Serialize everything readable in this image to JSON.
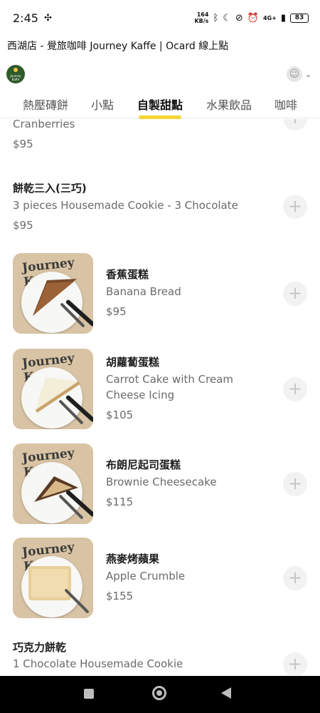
{
  "status": {
    "time": "2:45",
    "net_speed_value": "164",
    "net_speed_unit": "KB/s",
    "network": "4G+",
    "battery": "83"
  },
  "web_title": "西湖店 - 覺旅咖啡 Journey Kaffe | Ocard 線上點",
  "logo_text": "Journey Kaffe",
  "tabs": [
    {
      "label": "熱壓磚餅"
    },
    {
      "label": "小點"
    },
    {
      "label": "自製甜點",
      "active": true
    },
    {
      "label": "水果飲品"
    },
    {
      "label": "咖啡"
    }
  ],
  "items": [
    {
      "name": "",
      "desc": "Cranberries",
      "price": "$95"
    },
    {
      "name": "餅乾三入(三巧)",
      "desc": "3 pieces Housemade Cookie - 3 Chocolate",
      "price": "$95"
    },
    {
      "name": "香蕉蛋糕",
      "desc": "Banana Bread",
      "price": "$95"
    },
    {
      "name": "胡蘿蔔蛋糕",
      "desc": "Carrot Cake with Cream Cheese Icing",
      "price": "$105"
    },
    {
      "name": "布朗尼起司蛋糕",
      "desc": "Brownie Cheesecake",
      "price": "$115"
    },
    {
      "name": "燕麥烤蘋果",
      "desc": "Apple Crumble",
      "price": "$155"
    },
    {
      "name": "巧克力餅乾",
      "desc": "1 Chocolate Housemade Cookie",
      "price": ""
    }
  ],
  "photo_board_text": "Journey Ka",
  "add_icon": "+",
  "colors": {
    "accent": "#f5d536",
    "logo_bg": "#2f5a2a"
  }
}
